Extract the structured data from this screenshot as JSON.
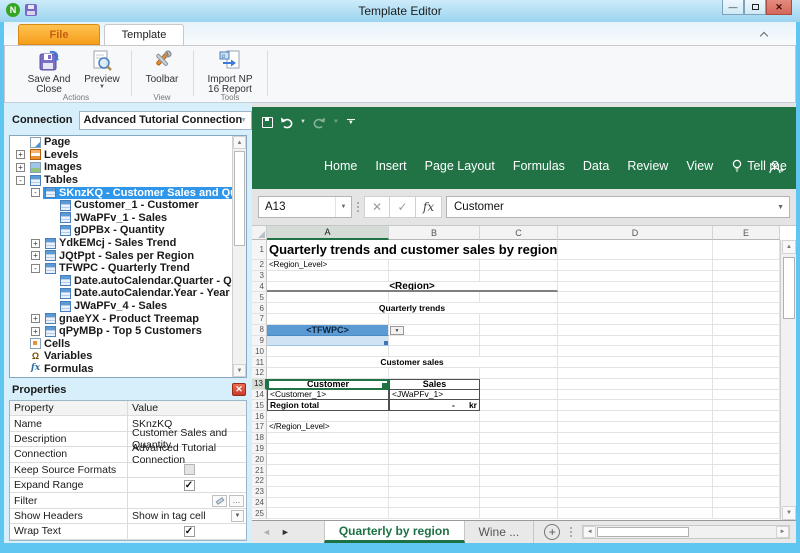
{
  "window": {
    "title": "Template Editor"
  },
  "colors": {
    "excel_green": "#217346",
    "frame_blue": "#5ec6f0",
    "file_tab_orange": "#f59d1b",
    "selection_blue": "#2f96ea",
    "tfwpc_fill": "#5b9bd5"
  },
  "ribbon": {
    "tabs": [
      {
        "label": "File"
      },
      {
        "label": "Template",
        "active": true
      }
    ],
    "buttons": [
      {
        "label": "Save And\nClose"
      },
      {
        "label": "Preview"
      },
      {
        "label": "Toolbar"
      },
      {
        "label": "Import NP\n16 Report"
      }
    ],
    "groups": [
      "Actions",
      "View",
      "Tools"
    ]
  },
  "left_panel": {
    "connection_label": "Connection",
    "connection_value": "Advanced Tutorial Connection",
    "tree": {
      "items": [
        {
          "label": "Page",
          "depth": 1,
          "icon": "page",
          "expander": "none"
        },
        {
          "label": "Levels",
          "depth": 1,
          "icon": "levels",
          "expander": "plus"
        },
        {
          "label": "Images",
          "depth": 1,
          "icon": "images",
          "expander": "plus"
        },
        {
          "label": "Tables",
          "depth": 1,
          "icon": "table",
          "expander": "minus"
        },
        {
          "label": "SKnzKQ - Customer Sales and Quantity",
          "depth": 2,
          "icon": "table",
          "expander": "minus",
          "selected": true
        },
        {
          "label": "Customer_1 - Customer",
          "depth": 3,
          "icon": "table",
          "expander": "none"
        },
        {
          "label": "JWaPFv_1 - Sales",
          "depth": 3,
          "icon": "table",
          "expander": "none"
        },
        {
          "label": "gDPBx - Quantity",
          "depth": 3,
          "icon": "table",
          "expander": "none"
        },
        {
          "label": "YdkEMcj - Sales Trend",
          "depth": 2,
          "icon": "table",
          "expander": "plus"
        },
        {
          "label": "JQtPpt - Sales per Region",
          "depth": 2,
          "icon": "table",
          "expander": "plus"
        },
        {
          "label": "TFWPC - Quarterly Trend",
          "depth": 2,
          "icon": "table",
          "expander": "minus"
        },
        {
          "label": "Date.autoCalendar.Quarter - Quarter",
          "depth": 3,
          "icon": "table",
          "expander": "none"
        },
        {
          "label": "Date.autoCalendar.Year - Year",
          "depth": 3,
          "icon": "table",
          "expander": "none"
        },
        {
          "label": "JWaPFv_4 - Sales",
          "depth": 3,
          "icon": "table",
          "expander": "none"
        },
        {
          "label": "gnaeYX - Product Treemap",
          "depth": 2,
          "icon": "table",
          "expander": "plus"
        },
        {
          "label": "qPyMBp - Top 5 Customers",
          "depth": 2,
          "icon": "table",
          "expander": "plus"
        },
        {
          "label": "Cells",
          "depth": 1,
          "icon": "cells",
          "expander": "none"
        },
        {
          "label": "Variables",
          "depth": 1,
          "icon": "variables",
          "expander": "none"
        },
        {
          "label": "Formulas",
          "depth": 1,
          "icon": "formulas",
          "expander": "none"
        }
      ]
    },
    "properties": {
      "title": "Properties",
      "columns": [
        "Property",
        "Value"
      ],
      "rows": [
        {
          "property": "Name",
          "type": "text",
          "value": "SKnzKQ"
        },
        {
          "property": "Description",
          "type": "text",
          "value": "Customer Sales and Quantity"
        },
        {
          "property": "Connection",
          "type": "text",
          "value": "Advanced Tutorial Connection"
        },
        {
          "property": "Keep Source Formats",
          "type": "checkbox",
          "checked": false
        },
        {
          "property": "Expand Range",
          "type": "checkbox",
          "checked": true
        },
        {
          "property": "Filter",
          "type": "filter",
          "value": ""
        },
        {
          "property": "Show Headers",
          "type": "dropdown",
          "value": "Show in tag cell"
        },
        {
          "property": "Wrap Text",
          "type": "checkbox",
          "checked": true
        }
      ]
    }
  },
  "excel": {
    "menu": [
      "Home",
      "Insert",
      "Page Layout",
      "Formulas",
      "Data",
      "Review",
      "View"
    ],
    "tell_me": "Tell me",
    "name_box": "A13",
    "formula_bar": "Customer",
    "columns": [
      "A",
      "B",
      "C",
      "D",
      "E"
    ],
    "selected_column": "A",
    "selected_row": 13,
    "row_count": 25,
    "cells": [
      {
        "r": 1,
        "c": "A",
        "text": "Quarterly trends and customer sales by region",
        "cls": "c-title"
      },
      {
        "r": 2,
        "c": "A",
        "text": "<Region_Level>",
        "cls": "c-tag"
      },
      {
        "r": 4,
        "c": "A",
        "span": 3,
        "text": "<Region>",
        "cls": "c-region"
      },
      {
        "r": 6,
        "c": "A",
        "span": 3,
        "text": "Quarterly trends",
        "cls": "c-section"
      },
      {
        "r": 8,
        "c": "A",
        "text": "<TFWPC>",
        "cls": "c-tfwpc"
      },
      {
        "r": 8,
        "c": "B",
        "text": "",
        "cls": "c-dd"
      },
      {
        "r": 9,
        "c": "A",
        "text": "",
        "cls": "c-tfwpc-ext"
      },
      {
        "r": 11,
        "c": "A",
        "span": 3,
        "text": "Customer sales",
        "cls": "c-section"
      },
      {
        "r": 13,
        "c": "A",
        "text": "Customer",
        "cls": "c-th c-sel"
      },
      {
        "r": 13,
        "c": "B",
        "text": "Sales",
        "cls": "c-th"
      },
      {
        "r": 14,
        "c": "A",
        "text": "<Customer_1>",
        "cls": "c-tcell"
      },
      {
        "r": 14,
        "c": "B",
        "text": "<JWaPFv_1>",
        "cls": "c-tcell"
      },
      {
        "r": 15,
        "c": "A",
        "text": "Region total",
        "cls": "c-tcell c-boldl"
      },
      {
        "r": 15,
        "c": "B",
        "text": "-      kr",
        "cls": "c-tcell c-money"
      },
      {
        "r": 17,
        "c": "A",
        "text": "</Region_Level>",
        "cls": "c-tag"
      }
    ],
    "sheet_tabs": [
      {
        "label": "Quarterly by region",
        "active": true
      },
      {
        "label": "Wine ...",
        "active": false
      }
    ]
  }
}
